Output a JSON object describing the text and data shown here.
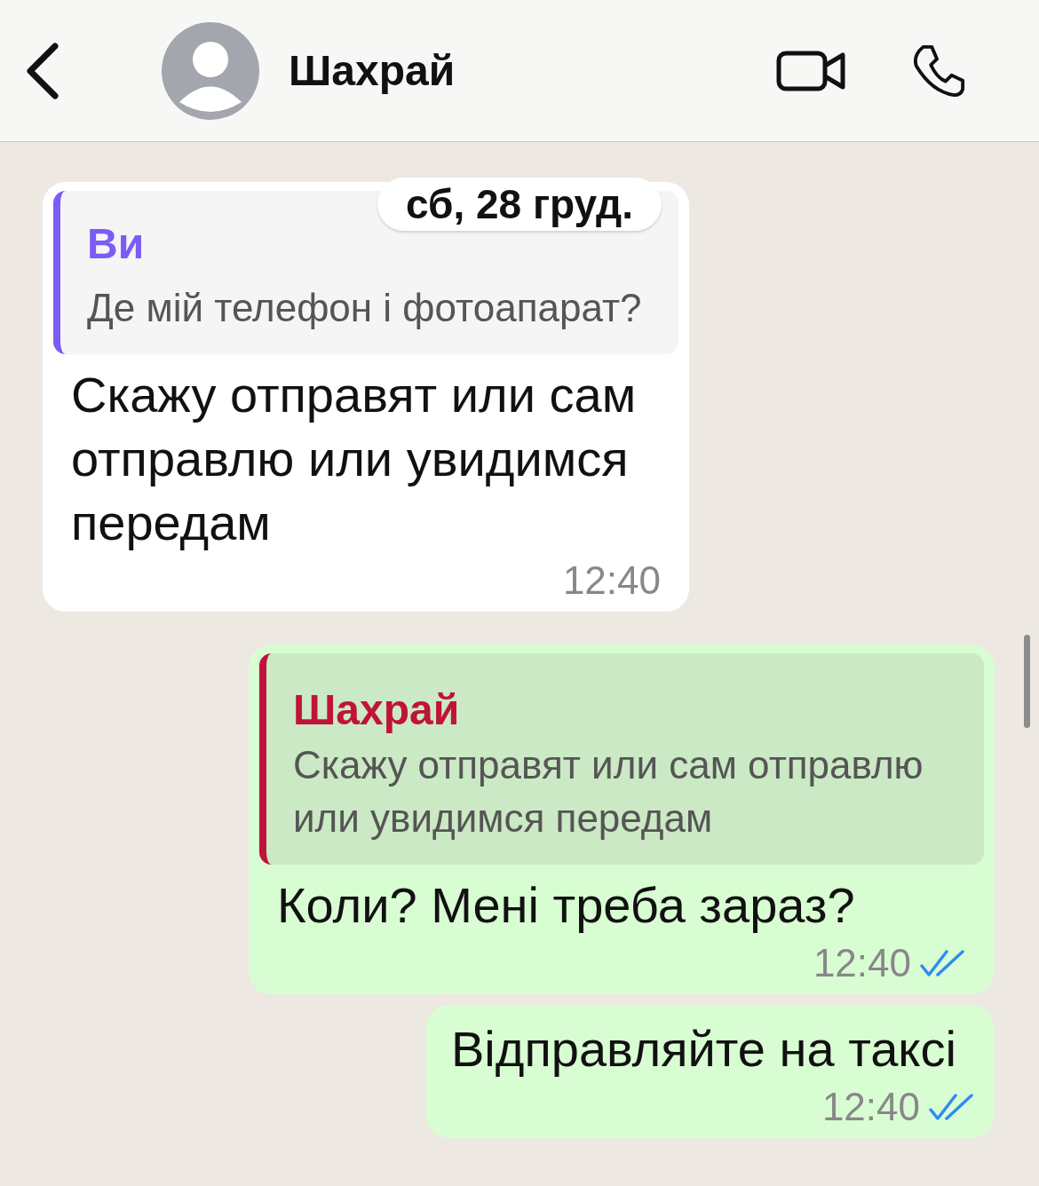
{
  "header": {
    "title": "Шахрай"
  },
  "date_label": "сб, 28 груд.",
  "messages": [
    {
      "kind": "incoming",
      "quote": {
        "author": "Ви",
        "text": "Де мій телефон і фотоапарат?",
        "kind": "mine"
      },
      "text": "Скажу отправят или сам отправлю или увидимся передам",
      "time": "12:40"
    },
    {
      "kind": "outgoing",
      "quote": {
        "author": "Шахрай",
        "text": "Скажу отправят или сам отправлю или увидимся передам",
        "kind": "theirs"
      },
      "text": "Коли? Мені треба зараз?",
      "time": "12:40",
      "read": true
    },
    {
      "kind": "outgoing",
      "text": "Відправляйте на таксі",
      "time": "12:40",
      "read": true
    }
  ]
}
